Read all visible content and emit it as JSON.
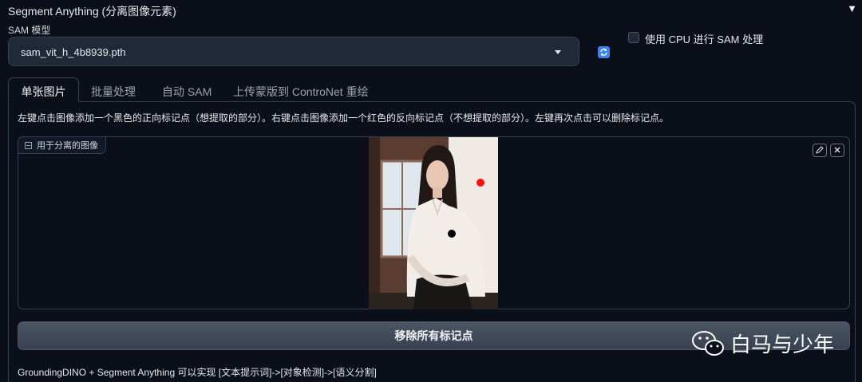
{
  "accordion": {
    "title": "Segment Anything (分离图像元素)",
    "toggle": "▼"
  },
  "sam": {
    "label": "SAM 模型",
    "selected": "sam_vit_h_4b8939.pth",
    "cpu_label": "使用 CPU 进行 SAM 处理",
    "cpu_checked": false
  },
  "tabs": [
    {
      "label": "单张图片",
      "active": true
    },
    {
      "label": "批量处理",
      "active": false
    },
    {
      "label": "自动 SAM",
      "active": false
    },
    {
      "label": "上传蒙版到 ControNet 重绘",
      "active": false
    }
  ],
  "instructions": "左键点击图像添加一个黑色的正向标记点（想提取的部分）。右键点击图像添加一个红色的反向标记点（不想提取的部分）。左键再次点击可以删除标记点。",
  "image_input": {
    "label": "用于分离的图像"
  },
  "markers": [
    {
      "kind": "negative",
      "color": "#ff1111"
    },
    {
      "kind": "positive",
      "color": "#000000"
    }
  ],
  "remove_button": "移除所有标记点",
  "footer": "GroundingDINO + Segment Anything 可以实现 [文本提示词]->[对象检测]->[语义分割]",
  "watermark": "白马与少年",
  "colors": {
    "bg": "#0b0f19",
    "accent": "#3b82f6",
    "border": "#374151"
  }
}
